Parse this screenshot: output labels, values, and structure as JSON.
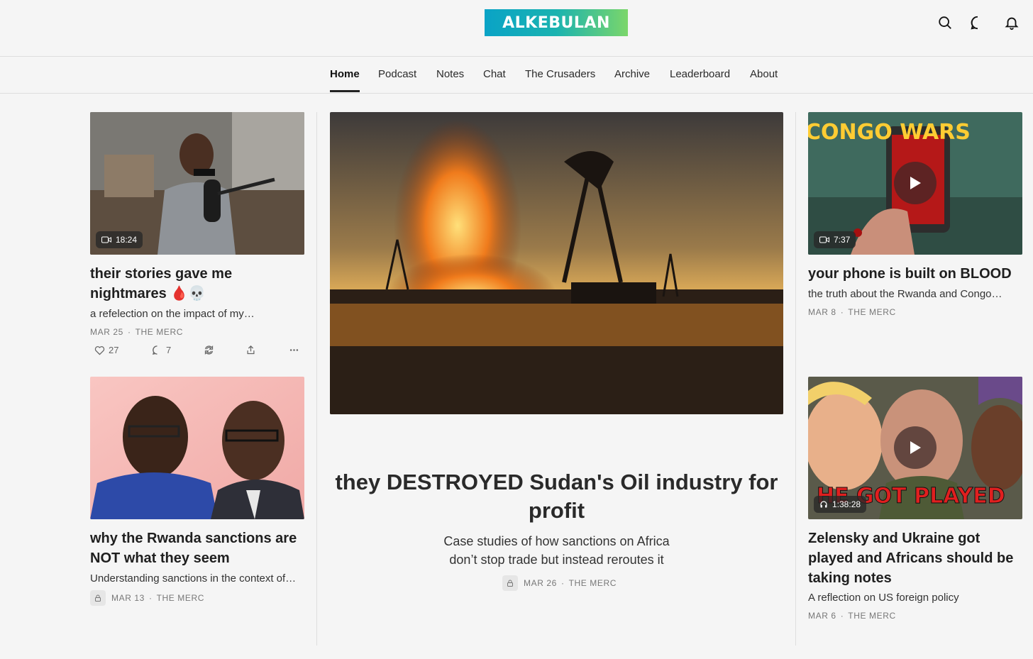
{
  "brand": {
    "logo_text": "ALKEBULAN",
    "accent_from": "#0aa3c6",
    "accent_to": "#7bd66a"
  },
  "header_icons": [
    "search-icon",
    "chat-bubble-icon",
    "bell-icon"
  ],
  "nav": {
    "items": [
      {
        "label": "Home",
        "active": true
      },
      {
        "label": "Podcast"
      },
      {
        "label": "Notes"
      },
      {
        "label": "Chat"
      },
      {
        "label": "The Crusaders"
      },
      {
        "label": "Archive"
      },
      {
        "label": "Leaderboard"
      },
      {
        "label": "About"
      }
    ]
  },
  "posts": {
    "left_top": {
      "duration": "18:24",
      "title": "their stories gave me nightmares 🩸💀",
      "subtitle": "a refelection on the impact of my…",
      "date": "MAR 25",
      "author": "THE MERC",
      "likes": "27",
      "comments": "7"
    },
    "left_bottom": {
      "title": "why the Rwanda sanctions are NOT what they seem",
      "subtitle": "Understanding sanctions in the context of…",
      "date": "MAR 13",
      "author": "THE MERC"
    },
    "hero": {
      "title": "they DESTROYED Sudan's Oil industry for profit",
      "subtitle": "Case studies of how sanctions on Africa don’t stop trade but instead reroutes it",
      "date": "MAR 26",
      "author": "THE MERC"
    },
    "right_top": {
      "thumb_text": "CONGO WARS",
      "duration": "7:37",
      "title": "your phone is built on BLOOD",
      "subtitle": "the truth about the Rwanda and Congo…",
      "date": "MAR 8",
      "author": "THE MERC"
    },
    "right_bottom": {
      "thumb_text": "HE GOT PLAYED",
      "duration": "1:38:28",
      "title": "Zelensky and Ukraine got played and Africans should be taking notes",
      "subtitle": "A reflection on US foreign policy",
      "date": "MAR 6",
      "author": "THE MERC"
    }
  },
  "separator": "·"
}
